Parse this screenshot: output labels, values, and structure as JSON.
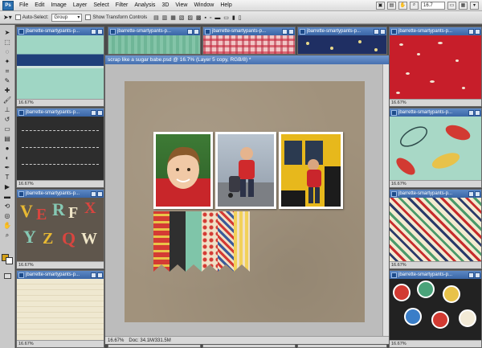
{
  "menubar": {
    "logo": "Ps",
    "items": [
      "File",
      "Edit",
      "Image",
      "Layer",
      "Select",
      "Filter",
      "Analysis",
      "3D",
      "View",
      "Window",
      "Help"
    ],
    "zoom": "16.7"
  },
  "options": {
    "auto_select_label": "Auto-Select:",
    "auto_select_value": "Group",
    "transform_label": "Show Transform Controls"
  },
  "left_windows": [
    {
      "title": "jbarrette-smartypants-p...",
      "zoom": "16.67%"
    },
    {
      "title": "jbarrette-smartypants-p...",
      "zoom": "16.67%"
    },
    {
      "title": "jbarrette-smartypants-p...",
      "zoom": "16.67%"
    },
    {
      "title": "jbarrette-smartypants-p...",
      "zoom": "16.67%"
    }
  ],
  "right_windows": [
    {
      "title": "jbarrette-smartypants-p...",
      "zoom": "16.67%"
    },
    {
      "title": "jbarrette-smartypants-p...",
      "zoom": "16.67%"
    },
    {
      "title": "jbarrette-smartypants-p...",
      "zoom": "16.67%"
    },
    {
      "title": "jbarrette-smartypants-p...",
      "zoom": "16.67%"
    }
  ],
  "top_windows": [
    {
      "title": "jbarrette-smartypants-p..."
    },
    {
      "title": "jbarrette-smartypants-p..."
    },
    {
      "title": "jbarrette-smartypants-p..."
    }
  ],
  "bottom_windows": [
    {
      "zoom": "16.67%"
    },
    {
      "zoom": "16.67%"
    },
    {
      "zoom": "16.67%"
    },
    {
      "zoom": "16.67%"
    }
  ],
  "main_window": {
    "title": "scrap like a sugar babe.psd @ 16.7% (Layer 5 copy, RGB/8) *",
    "zoom": "16.67%",
    "doc": "Doc: 34.1M/331.5M"
  },
  "colors": {
    "foreground": "#d4a017",
    "background": "#ffffff",
    "titlebar": "#3a66a6"
  }
}
